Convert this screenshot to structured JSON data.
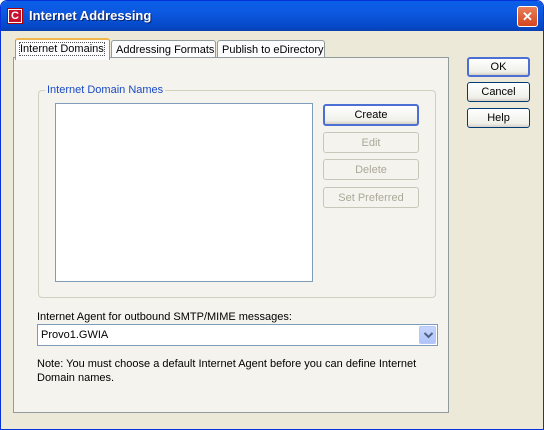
{
  "window": {
    "title": "Internet Addressing",
    "app_icon_letter": "C",
    "close_glyph": "✕"
  },
  "tabs": [
    {
      "label": "Internet Domains",
      "active": true
    },
    {
      "label": "Addressing Formats",
      "active": false
    },
    {
      "label": "Publish to eDirectory",
      "active": false
    }
  ],
  "group": {
    "title": "Internet Domain Names",
    "domain_names": []
  },
  "list_buttons": {
    "create": "Create",
    "edit": "Edit",
    "delete": "Delete",
    "set_preferred": "Set Preferred"
  },
  "agent": {
    "label": "Internet Agent for outbound SMTP/MIME messages:",
    "selected": "Provo1.GWIA"
  },
  "note": "Note:  You must choose a default Internet Agent before you can define Internet Domain names.",
  "dialog_buttons": {
    "ok": "OK",
    "cancel": "Cancel",
    "help": "Help"
  },
  "colors": {
    "titlebar": "#0a5fe8",
    "group_title": "#1a4bc4",
    "dialog_face": "#ece9d8",
    "active_tab_accent": "#f0b84c"
  },
  "icons": {
    "app": "app-logo-icon",
    "close": "close-icon",
    "dropdown": "chevron-down-icon"
  }
}
